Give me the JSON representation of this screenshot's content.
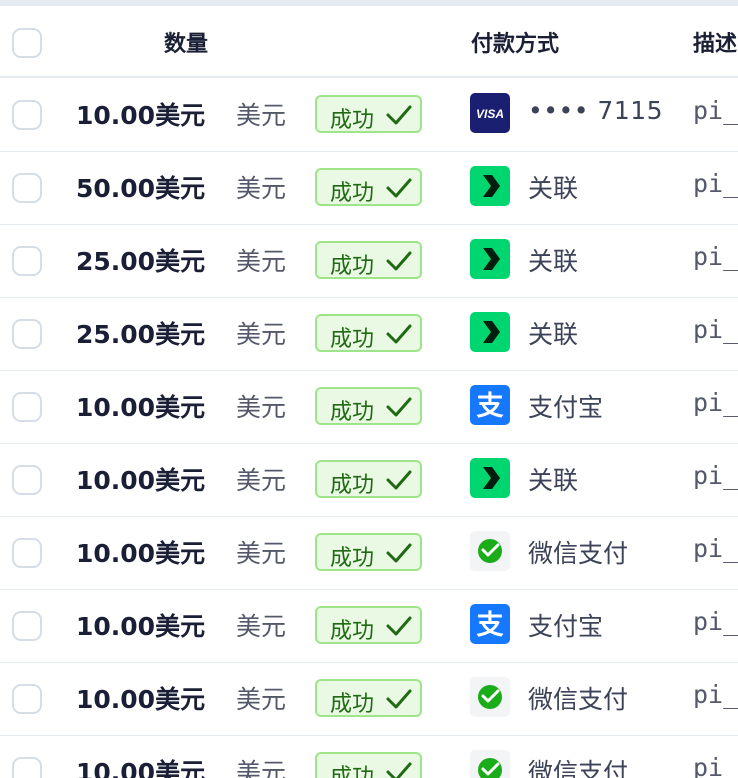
{
  "header": {
    "amount": "数量",
    "payment_method": "付款方式",
    "description": "描述"
  },
  "rows": [
    {
      "amount": "10.00美元",
      "currency": "美元",
      "status": "成功",
      "method_icon": "visa-icon",
      "method": "•••• 7115",
      "description": "pi_"
    },
    {
      "amount": "50.00美元",
      "currency": "美元",
      "status": "成功",
      "method_icon": "link-icon",
      "method": "关联",
      "description": "pi_"
    },
    {
      "amount": "25.00美元",
      "currency": "美元",
      "status": "成功",
      "method_icon": "link-icon",
      "method": "关联",
      "description": "pi_"
    },
    {
      "amount": "25.00美元",
      "currency": "美元",
      "status": "成功",
      "method_icon": "link-icon",
      "method": "关联",
      "description": "pi_"
    },
    {
      "amount": "10.00美元",
      "currency": "美元",
      "status": "成功",
      "method_icon": "alipay-icon",
      "method": "支付宝",
      "description": "pi_"
    },
    {
      "amount": "10.00美元",
      "currency": "美元",
      "status": "成功",
      "method_icon": "link-icon",
      "method": "关联",
      "description": "pi_"
    },
    {
      "amount": "10.00美元",
      "currency": "美元",
      "status": "成功",
      "method_icon": "wechat-pay-icon",
      "method": "微信支付",
      "description": "pi_"
    },
    {
      "amount": "10.00美元",
      "currency": "美元",
      "status": "成功",
      "method_icon": "alipay-icon",
      "method": "支付宝",
      "description": "pi_"
    },
    {
      "amount": "10.00美元",
      "currency": "美元",
      "status": "成功",
      "method_icon": "wechat-pay-icon",
      "method": "微信支付",
      "description": "pi_"
    },
    {
      "amount": "10.00美元",
      "currency": "美元",
      "status": "成功",
      "method_icon": "wechat-pay-icon",
      "method": "微信支付",
      "description": "pi_"
    }
  ],
  "colors": {
    "status_bg": "#eaf9e4",
    "status_border": "#9ee58a",
    "status_text": "#1f6a12",
    "visa": "#1a1f71",
    "link": "#00d66f",
    "alipay": "#1677ff",
    "wechat": "#1aad19"
  }
}
